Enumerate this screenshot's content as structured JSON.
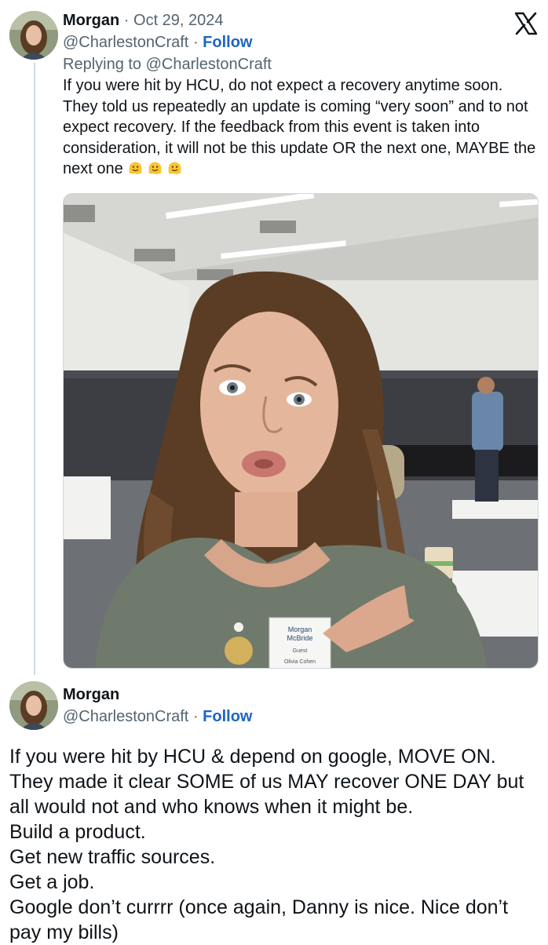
{
  "brand": {
    "logo_icon": "x-logo-icon",
    "accent": "#1d65c1",
    "text": "#0f1419",
    "secondary_text": "#536471"
  },
  "tweet1": {
    "author_name": "Morgan",
    "separator": "·",
    "date": "Oct 29, 2024",
    "handle": "@CharlestonCraft",
    "follow_label": "Follow",
    "reply_prefix": "Replying to",
    "reply_to": "@CharlestonCraft",
    "text_lines": [
      "If you were hit by HCU, do not expect a recovery anytime soon.",
      "They told us repeatedly an update is coming “very soon” and to not",
      "expect recovery. If the feedback from this event is taken into",
      "consideration, it will not be this update OR the next one, MAYBE the",
      "next one"
    ],
    "emojis": [
      "melting-face-icon",
      "melting-face-icon",
      "melting-face-icon"
    ],
    "badge_lines": [
      "Morgan",
      "McBride",
      "Guest",
      "Olivia Cohen"
    ]
  },
  "tweet2": {
    "author_name": "Morgan",
    "separator": "·",
    "handle": "@CharlestonCraft",
    "follow_label": "Follow",
    "text_lines": [
      "If you were hit by HCU & depend on google, MOVE ON.",
      "They made it clear SOME of us MAY recover ONE DAY but",
      "all would not and who knows when it might be.",
      "Build a product.",
      "Get new traffic sources.",
      "Get a job.",
      "Google don’t currrr (once again, Danny is nice. Nice don’t",
      "pay my bills)"
    ]
  }
}
